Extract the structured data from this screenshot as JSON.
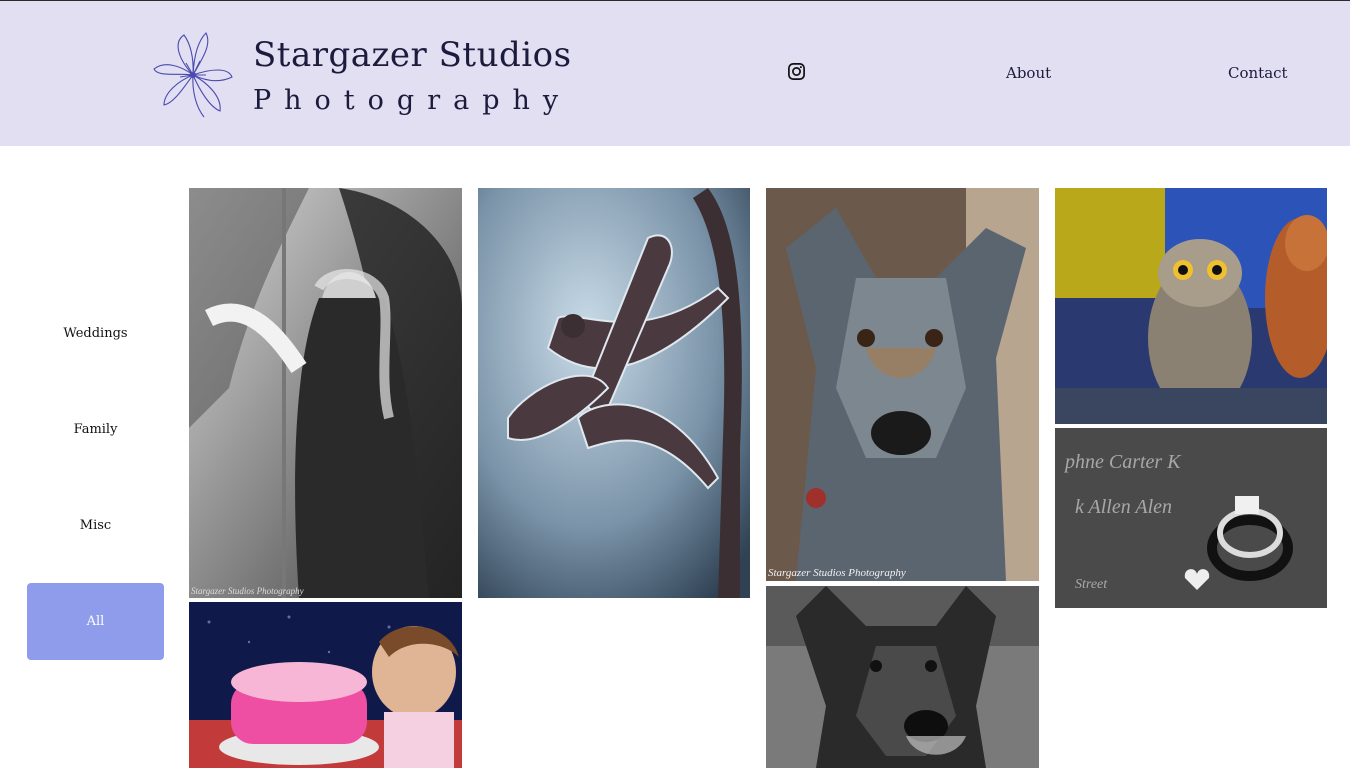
{
  "header": {
    "title": "Stargazer Studios",
    "subtitle": "Photography",
    "nav": {
      "about": "About",
      "contact": "Contact"
    },
    "icons": {
      "logo": "lily-flower-logo",
      "social": "instagram-icon"
    }
  },
  "sidebar": {
    "items": [
      {
        "label": "Weddings",
        "active": false
      },
      {
        "label": "Family",
        "active": false
      },
      {
        "label": "Misc",
        "active": false
      },
      {
        "label": "All",
        "active": true
      }
    ]
  },
  "gallery": {
    "watermark": "Stargazer Studios Photography",
    "photos": [
      {
        "subject": "archer girl in black and white"
      },
      {
        "subject": "iced metal dragonfly"
      },
      {
        "subject": "blue heeler dog"
      },
      {
        "subject": "screech owls"
      },
      {
        "subject": "baby eating pink cake"
      },
      {
        "subject": "dog in black and white"
      },
      {
        "subject": "wedding rings on invitation"
      }
    ]
  },
  "colors": {
    "header_bg": "#e1dff1",
    "accent": "#8f9ceb",
    "text": "#1d1b3d"
  }
}
